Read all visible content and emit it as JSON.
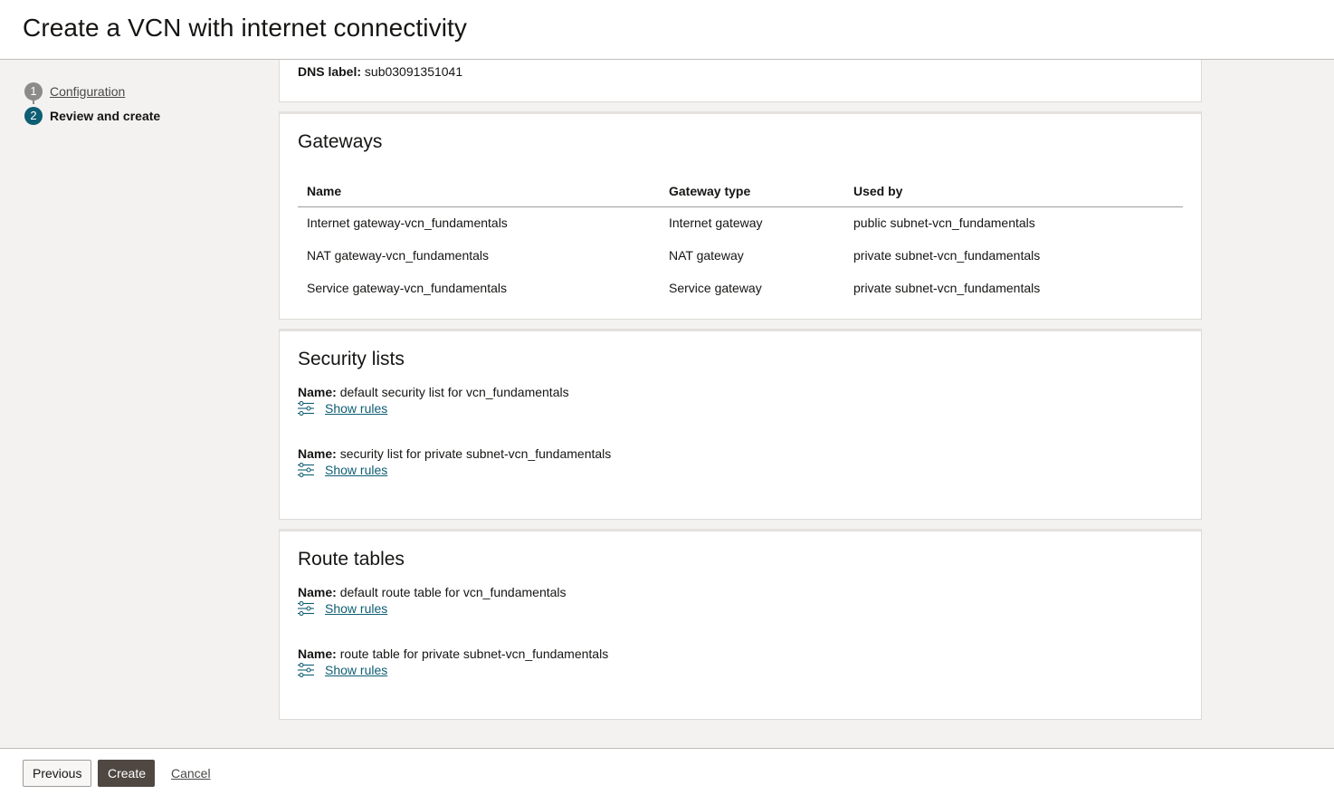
{
  "header": {
    "title": "Create a VCN with internet connectivity"
  },
  "steps": [
    {
      "number": "1",
      "label": "Configuration"
    },
    {
      "number": "2",
      "label": "Review and create"
    }
  ],
  "subnet": {
    "dns_label_key": "DNS label:",
    "dns_label_value": "sub03091351041"
  },
  "gateways": {
    "title": "Gateways",
    "columns": [
      "Name",
      "Gateway type",
      "Used by"
    ],
    "rows": [
      [
        "Internet gateway-vcn_fundamentals",
        "Internet gateway",
        "public subnet-vcn_fundamentals"
      ],
      [
        "NAT gateway-vcn_fundamentals",
        "NAT gateway",
        "private subnet-vcn_fundamentals"
      ],
      [
        "Service gateway-vcn_fundamentals",
        "Service gateway",
        "private subnet-vcn_fundamentals"
      ]
    ]
  },
  "security_lists": {
    "title": "Security lists",
    "name_key": "Name:",
    "items": [
      {
        "name": "default security list for vcn_fundamentals",
        "link": "Show rules"
      },
      {
        "name": "security list for private subnet-vcn_fundamentals",
        "link": "Show rules"
      }
    ]
  },
  "route_tables": {
    "title": "Route tables",
    "name_key": "Name:",
    "items": [
      {
        "name": "default route table for vcn_fundamentals",
        "link": "Show rules"
      },
      {
        "name": "route table for private subnet-vcn_fundamentals",
        "link": "Show rules"
      }
    ]
  },
  "footer": {
    "previous": "Previous",
    "create": "Create",
    "cancel": "Cancel"
  },
  "colors": {
    "accent": "#0e5e74",
    "primary_button": "#4f4741",
    "step_done": "#8d8b88"
  },
  "icons": {
    "rules": "sliders-icon"
  }
}
